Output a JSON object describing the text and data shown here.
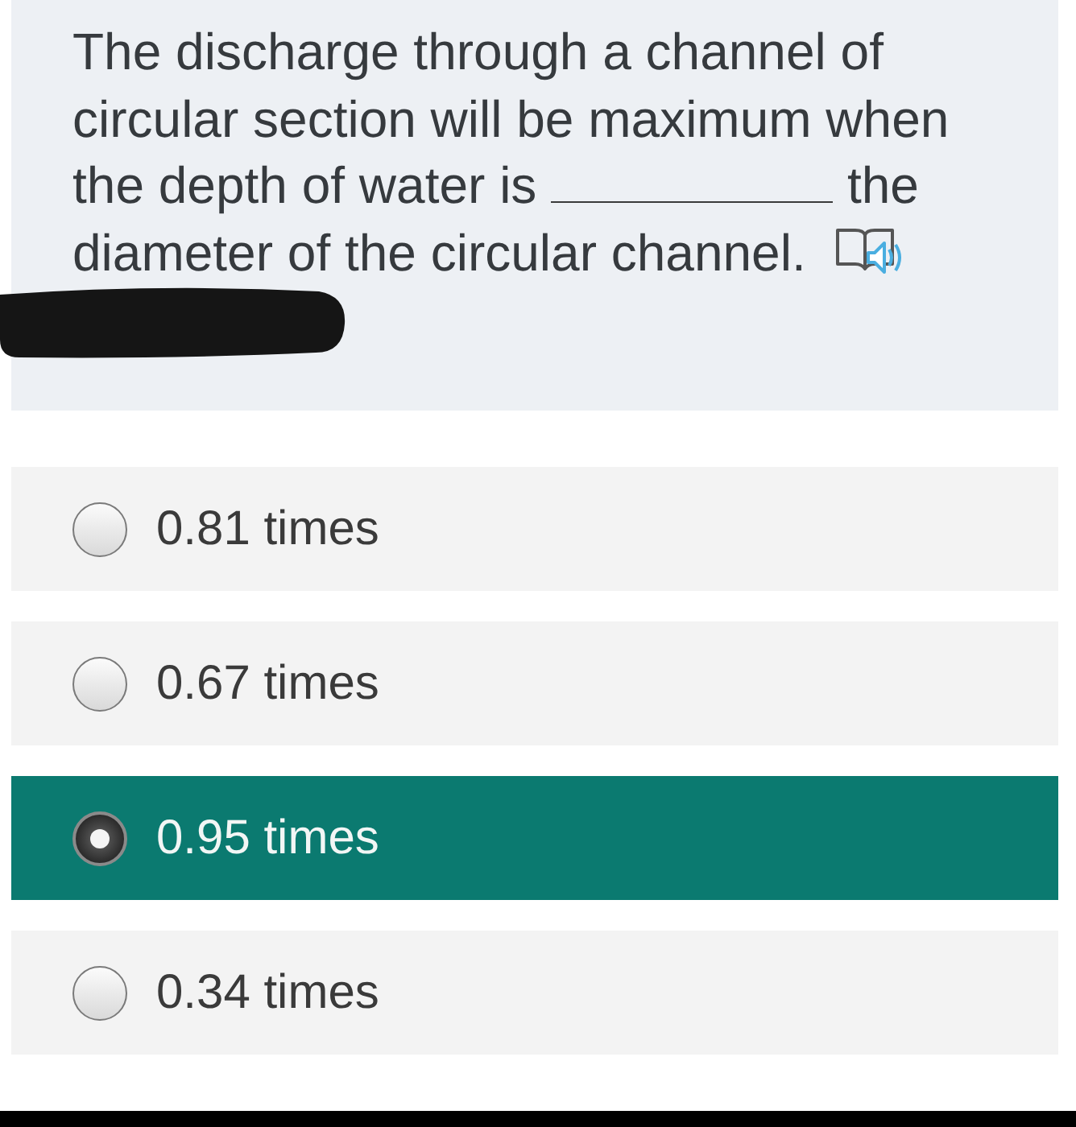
{
  "question": {
    "parts": [
      {
        "kind": "text",
        "text": "The discharge through a channel of"
      },
      {
        "kind": "text",
        "text": "circular section will be maximum when"
      },
      {
        "kind": "text",
        "text": "the depth of water is"
      },
      {
        "kind": "blank"
      },
      {
        "kind": "text",
        "text": "the"
      },
      {
        "kind": "text",
        "text": "diameter of the circular channel."
      }
    ],
    "read_aloud": true
  },
  "redaction_mark": true,
  "options": [
    {
      "label": "0.81 times",
      "selected": false
    },
    {
      "label": "0.67 times",
      "selected": false
    },
    {
      "label": "0.95 times",
      "selected": true
    },
    {
      "label": "0.34 times",
      "selected": false
    }
  ]
}
